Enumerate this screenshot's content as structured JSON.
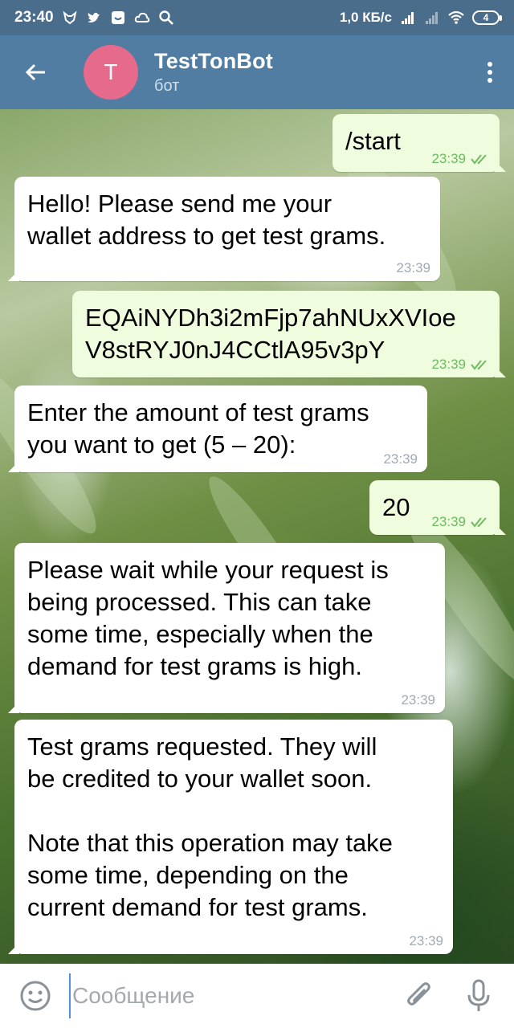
{
  "status_bar": {
    "time": "23:40",
    "net_speed": "1,0 КБ/с",
    "battery": "4"
  },
  "header": {
    "avatar_letter": "T",
    "title": "TestTonBot",
    "subtitle": "бот"
  },
  "messages": [
    {
      "direction": "out",
      "text": "/start",
      "time": "23:39"
    },
    {
      "direction": "in",
      "text": "Hello! Please send me your\nwallet address to get test grams.",
      "time": "23:39"
    },
    {
      "direction": "out",
      "text": "EQAiNYDh3i2mFjp7ahNUxXVIoe\nV8stRYJ0nJ4CCtlA95v3pY",
      "time": "23:39"
    },
    {
      "direction": "in",
      "text": "Enter the amount of test grams\nyou want to get (5 – 20):",
      "time": "23:39"
    },
    {
      "direction": "out",
      "text": "20",
      "time": "23:39"
    },
    {
      "direction": "in",
      "text": "Please wait while your request is\nbeing processed. This can take\nsome time, especially when the\ndemand for test grams is high.",
      "time": "23:39"
    },
    {
      "direction": "in",
      "text": "Test grams requested. They will\nbe credited to your wallet soon.\n\nNote that this operation may take\nsome time, depending on the\ncurrent demand for test grams.",
      "time": "23:39"
    }
  ],
  "input": {
    "placeholder": "Сообщение"
  },
  "colors": {
    "header": "#517da2",
    "status_bar": "#4a6d8b",
    "avatar": "#e56a8c",
    "incoming_bubble": "#ffffff",
    "outgoing_bubble": "#effdde",
    "read_check": "#6cbc5f"
  }
}
